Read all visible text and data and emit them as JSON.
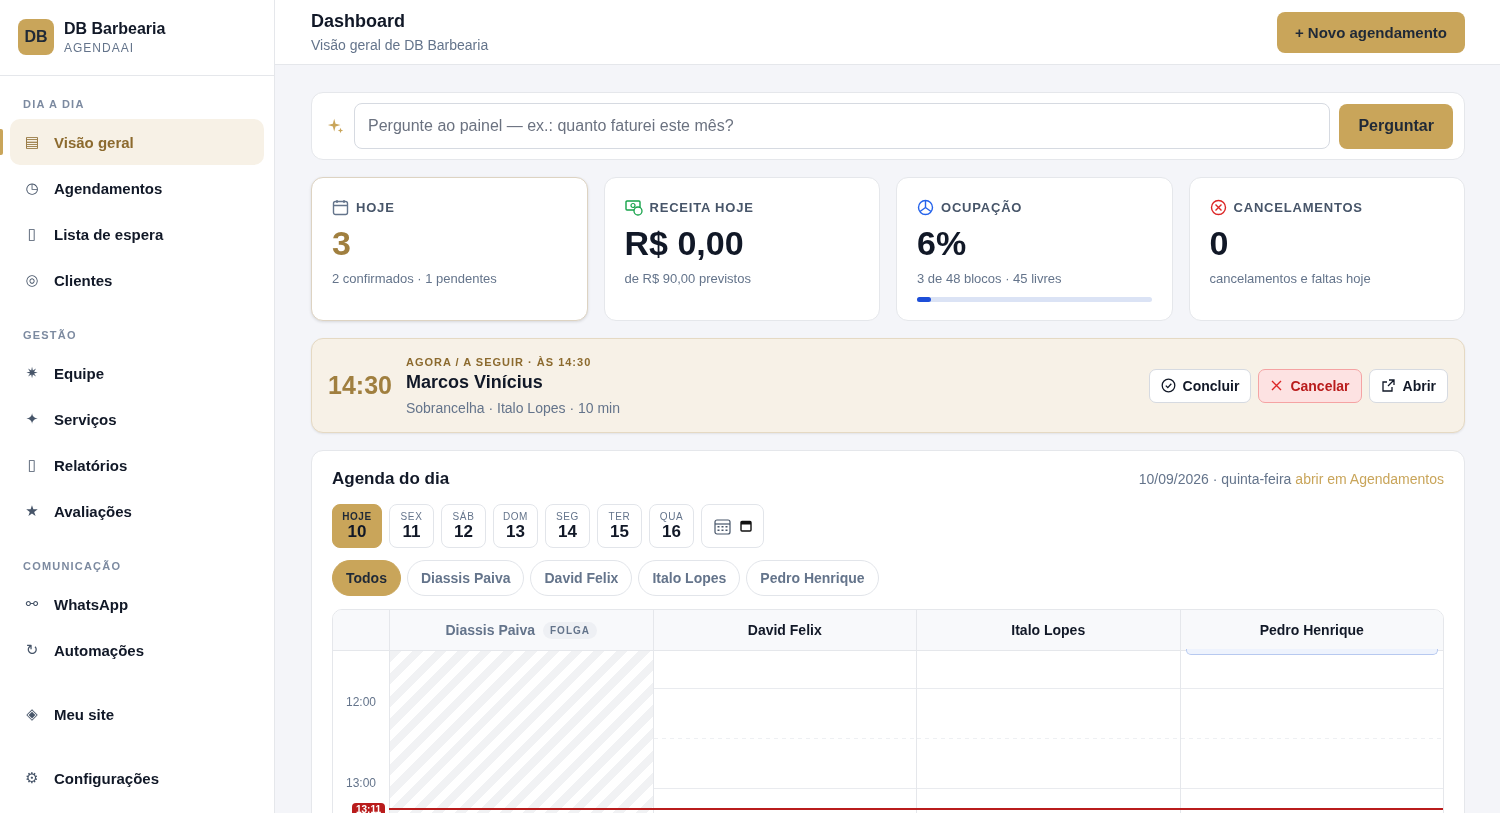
{
  "brand": {
    "initials": "DB",
    "name": "DB Barbearia",
    "subtitle": "AGENDAAI"
  },
  "sidebar": {
    "sections": [
      {
        "title": "DIA A DIA",
        "items": [
          {
            "icon": "▤",
            "label": "Visão geral",
            "selected": true
          },
          {
            "icon": "◷",
            "label": "Agendamentos",
            "selected": false
          },
          {
            "icon": "▯",
            "label": "Lista de espera",
            "selected": false
          },
          {
            "icon": "◎",
            "label": "Clientes",
            "selected": false
          }
        ]
      },
      {
        "title": "GESTÃO",
        "items": [
          {
            "icon": "✷",
            "label": "Equipe",
            "selected": false
          },
          {
            "icon": "✦",
            "label": "Serviços",
            "selected": false
          },
          {
            "icon": "▯",
            "label": "Relatórios",
            "selected": false
          },
          {
            "icon": "★",
            "label": "Avaliações",
            "selected": false
          }
        ]
      },
      {
        "title": "COMUNICAÇÃO",
        "items": [
          {
            "icon": "⚯",
            "label": "WhatsApp",
            "selected": false
          },
          {
            "icon": "↻",
            "label": "Automações",
            "selected": false
          }
        ]
      },
      {
        "items": [
          {
            "icon": "◈",
            "label": "Meu site",
            "selected": false
          }
        ]
      },
      {
        "items": [
          {
            "icon": "⚙",
            "label": "Configurações",
            "selected": false
          }
        ]
      }
    ]
  },
  "header": {
    "title": "Dashboard",
    "subtitle": "Visão geral de DB Barbearia",
    "action": "+ Novo agendamento"
  },
  "ask": {
    "placeholder": "Pergunte ao painel — ex.: quanto faturei este mês?",
    "button": "Perguntar"
  },
  "stats": [
    {
      "kind": "calendar",
      "label": "HOJE",
      "value": "3",
      "note": "2 confirmados · 1 pendentes",
      "selected": true
    },
    {
      "kind": "money",
      "label": "RECEITA HOJE",
      "value": "R$ 0,00",
      "note": "de R$ 90,00 previstos",
      "selected": false
    },
    {
      "kind": "pie",
      "label": "OCUPAÇÃO",
      "value": "6%",
      "note": "3 de 48 blocos · 45 livres",
      "level": 0.06,
      "selected": false
    },
    {
      "kind": "cancel",
      "label": "CANCELAMENTOS",
      "value": "0",
      "note": "cancelamentos e faltas hoje",
      "selected": false
    }
  ],
  "next": {
    "time": "14:30",
    "eyebrow": "AGORA / A SEGUIR · ÀS 14:30",
    "client": "Marcos Vinícius",
    "details": "Sobrancelha · Italo Lopes · 10 min",
    "actions": [
      {
        "kind": "done",
        "label": "Concluir"
      },
      {
        "kind": "cancel",
        "label": "Cancelar"
      },
      {
        "kind": "open",
        "label": "Abrir"
      }
    ]
  },
  "agenda": {
    "title": "Agenda do dia",
    "date": "10/09/2026 · quinta-feira",
    "link": "abrir em Agendamentos",
    "days": [
      {
        "weekday": "HOJE",
        "day": "10",
        "selected": true
      },
      {
        "weekday": "SEX",
        "day": "11",
        "selected": false
      },
      {
        "weekday": "SÁB",
        "day": "12",
        "selected": false
      },
      {
        "weekday": "DOM",
        "day": "13",
        "selected": false
      },
      {
        "weekday": "SEG",
        "day": "14",
        "selected": false
      },
      {
        "weekday": "TER",
        "day": "15",
        "selected": false
      },
      {
        "weekday": "QUA",
        "day": "16",
        "selected": false
      }
    ],
    "filters": [
      {
        "label": "Todos",
        "selected": true
      },
      {
        "label": "Diassis Paiva",
        "selected": false
      },
      {
        "label": "David Felix",
        "selected": false
      },
      {
        "label": "Italo Lopes",
        "selected": false
      },
      {
        "label": "Pedro Henrique",
        "selected": false
      }
    ],
    "columns": [
      {
        "name": "Diassis Paiva",
        "off": true,
        "badge": "FOLGA"
      },
      {
        "name": "David Felix",
        "off": false
      },
      {
        "name": "Italo Lopes",
        "off": false
      },
      {
        "name": "Pedro Henrique",
        "off": false,
        "appointment": true
      }
    ],
    "hours": [
      "12:00",
      "13:00"
    ],
    "now": "13:11"
  }
}
